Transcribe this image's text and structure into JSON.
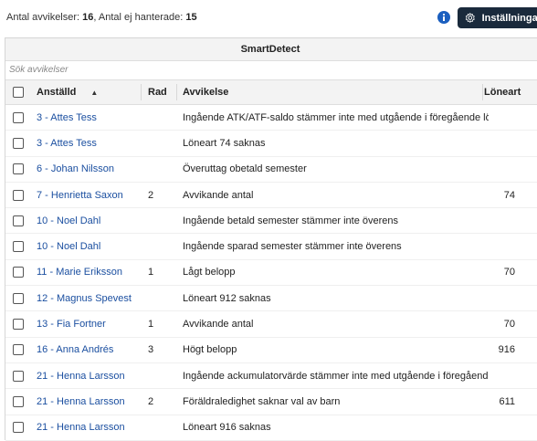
{
  "summary": {
    "count_label": "Antal avvikelser:",
    "count_value": "16",
    "unhandled_label": "Antal ej hanterade:",
    "unhandled_value": "15"
  },
  "toolbar": {
    "settings_label": "Inställningar",
    "info_icon": "info-icon",
    "settings_icon": "gear-icon"
  },
  "panel": {
    "title": "SmartDetect",
    "search_placeholder": "Sök avvikelser"
  },
  "table": {
    "columns": {
      "employee": "Anställd",
      "row": "Rad",
      "deviation": "Avvikelse",
      "wage_type": "Löneart"
    },
    "sort": {
      "column": "employee",
      "direction": "ascending"
    },
    "rows": [
      {
        "employee": "3 - Attes Tess",
        "row": "",
        "deviation": "Ingående ATK/ATF-saldo stämmer inte med utgående i föregående lö...",
        "wage_type": ""
      },
      {
        "employee": "3 - Attes Tess",
        "row": "",
        "deviation": "Löneart 74 saknas",
        "wage_type": ""
      },
      {
        "employee": "6 - Johan Nilsson",
        "row": "",
        "deviation": "Överuttag obetald semester",
        "wage_type": ""
      },
      {
        "employee": "7 - Henrietta Saxon",
        "row": "2",
        "deviation": "Avvikande antal",
        "wage_type": "74"
      },
      {
        "employee": "10 - Noel Dahl",
        "row": "",
        "deviation": "Ingående betald semester stämmer inte överens",
        "wage_type": ""
      },
      {
        "employee": "10 - Noel Dahl",
        "row": "",
        "deviation": "Ingående sparad semester stämmer inte överens",
        "wage_type": ""
      },
      {
        "employee": "11 - Marie Eriksson",
        "row": "1",
        "deviation": "Lågt belopp",
        "wage_type": "70"
      },
      {
        "employee": "12 - Magnus Spevest",
        "row": "",
        "deviation": "Löneart 912 saknas",
        "wage_type": ""
      },
      {
        "employee": "13 - Fia Fortner",
        "row": "1",
        "deviation": "Avvikande antal",
        "wage_type": "70"
      },
      {
        "employee": "16 - Anna Andrés",
        "row": "3",
        "deviation": "Högt belopp",
        "wage_type": "916"
      },
      {
        "employee": "21 - Henna Larsson",
        "row": "",
        "deviation": "Ingående ackumulatorvärde stämmer inte med utgående i föregående...",
        "wage_type": ""
      },
      {
        "employee": "21 - Henna Larsson",
        "row": "2",
        "deviation": "Föräldraledighet saknar val av barn",
        "wage_type": "611"
      },
      {
        "employee": "21 - Henna Larsson",
        "row": "",
        "deviation": "Löneart 916 saknas",
        "wage_type": ""
      }
    ]
  }
}
